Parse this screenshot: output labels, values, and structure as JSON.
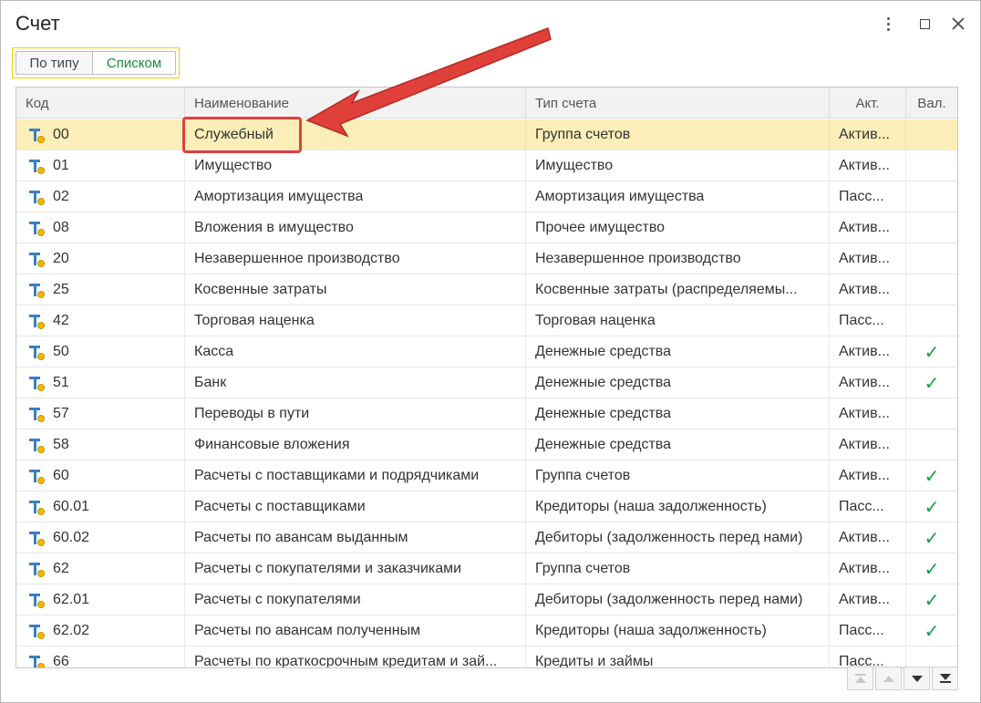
{
  "window": {
    "title": "Счет"
  },
  "view_toggle": {
    "by_type": "По типу",
    "list": "Списком"
  },
  "table": {
    "headers": {
      "code": "Код",
      "name": "Наименование",
      "type": "Тип счета",
      "akt": "Акт.",
      "val": "Вал."
    },
    "rows": [
      {
        "code": "00",
        "name": "Служебный",
        "type": "Группа счетов",
        "akt": "Актив...",
        "val": ""
      },
      {
        "code": "01",
        "name": "Имущество",
        "type": "Имущество",
        "akt": "Актив...",
        "val": ""
      },
      {
        "code": "02",
        "name": "Амортизация имущества",
        "type": "Амортизация имущества",
        "akt": "Пасс...",
        "val": ""
      },
      {
        "code": "08",
        "name": "Вложения в имущество",
        "type": "Прочее имущество",
        "akt": "Актив...",
        "val": ""
      },
      {
        "code": "20",
        "name": "Незавершенное производство",
        "type": "Незавершенное производство",
        "akt": "Актив...",
        "val": ""
      },
      {
        "code": "25",
        "name": "Косвенные затраты",
        "type": "Косвенные затраты (распределяемы...",
        "akt": "Актив...",
        "val": ""
      },
      {
        "code": "42",
        "name": "Торговая наценка",
        "type": "Торговая наценка",
        "akt": "Пасс...",
        "val": ""
      },
      {
        "code": "50",
        "name": "Касса",
        "type": "Денежные средства",
        "akt": "Актив...",
        "val": "✓"
      },
      {
        "code": "51",
        "name": "Банк",
        "type": "Денежные средства",
        "akt": "Актив...",
        "val": "✓"
      },
      {
        "code": "57",
        "name": "Переводы в пути",
        "type": "Денежные средства",
        "akt": "Актив...",
        "val": ""
      },
      {
        "code": "58",
        "name": "Финансовые вложения",
        "type": "Денежные средства",
        "akt": "Актив...",
        "val": ""
      },
      {
        "code": "60",
        "name": "Расчеты с поставщиками и подрядчиками",
        "type": "Группа счетов",
        "akt": "Актив...",
        "val": "✓"
      },
      {
        "code": "60.01",
        "name": "Расчеты с поставщиками",
        "type": "Кредиторы (наша задолженность)",
        "akt": "Пасс...",
        "val": "✓"
      },
      {
        "code": "60.02",
        "name": "Расчеты по авансам выданным",
        "type": "Дебиторы (задолженность перед нами)",
        "akt": "Актив...",
        "val": "✓"
      },
      {
        "code": "62",
        "name": "Расчеты с покупателями и заказчиками",
        "type": "Группа счетов",
        "akt": "Актив...",
        "val": "✓"
      },
      {
        "code": "62.01",
        "name": "Расчеты с покупателями",
        "type": "Дебиторы (задолженность перед нами)",
        "akt": "Актив...",
        "val": "✓"
      },
      {
        "code": "62.02",
        "name": "Расчеты по авансам полученным",
        "type": "Кредиторы (наша задолженность)",
        "akt": "Пасс...",
        "val": "✓"
      },
      {
        "code": "66",
        "name": "Расчеты по краткосрочным кредитам и зай...",
        "type": "Кредиты и займы",
        "akt": "Пасс...",
        "val": ""
      }
    ]
  },
  "colors": {
    "selected_row": "#fbeeb8",
    "toggle_active_text": "#1a8a3a",
    "check": "#1a9a46",
    "annotation": "#e0403a"
  }
}
